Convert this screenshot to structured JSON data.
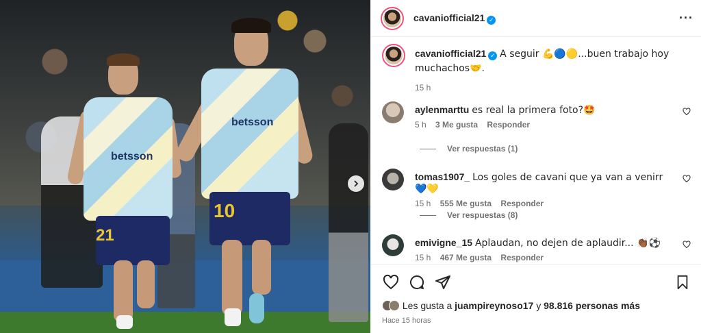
{
  "post": {
    "author": "cavaniofficial21",
    "caption_text": "A seguir 💪🔵🟡...buen trabajo hoy muchachos🤝.",
    "caption_time": "15 h",
    "sponsor": "betsson",
    "player_numbers": [
      "21",
      "10"
    ]
  },
  "comments": [
    {
      "user": "aylenmarttu",
      "text": "es real la primera foto?🤩",
      "time": "5 h",
      "likes": "3 Me gusta",
      "reply": "Responder",
      "replies": "Ver respuestas (1)"
    },
    {
      "user": "tomas1907_",
      "text": "Los goles de cavani que ya van a venirr💙💛",
      "time": "15 h",
      "likes": "555 Me gusta",
      "reply": "Responder",
      "replies": "Ver respuestas (8)"
    },
    {
      "user": "emivigne_15",
      "text": "Aplaudan, no dejen de aplaudir... 👏🏾⚽",
      "time": "15 h",
      "likes": "467 Me gusta",
      "reply": "Responder"
    }
  ],
  "likes": {
    "prefix": "Les gusta a ",
    "user": "juampireynoso17",
    "connector": " y ",
    "count": "98.816 personas más"
  },
  "posted": "Hace 15 horas",
  "icons": {
    "like": "heart-icon",
    "comment": "comment-icon",
    "share": "share-icon",
    "save": "bookmark-icon",
    "more": "more-options-icon",
    "next": "chevron-right-icon"
  },
  "colors": {
    "verified": "#0095f6",
    "story_ring": "#ef4f7b",
    "secondary_text": "#737373"
  }
}
